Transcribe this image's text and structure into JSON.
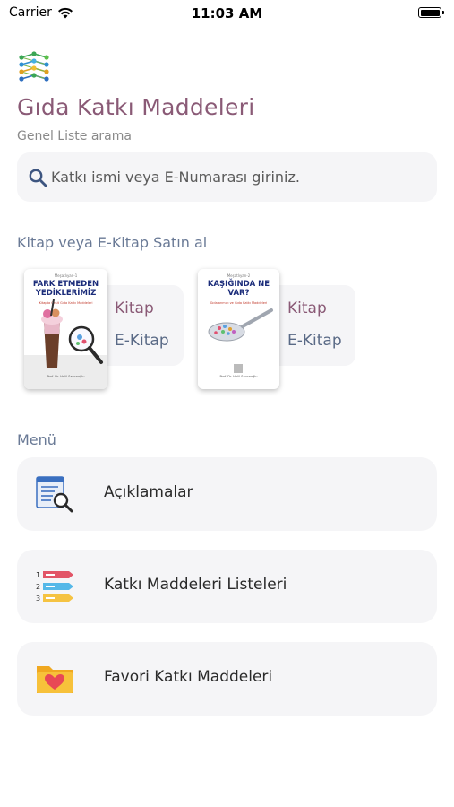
{
  "status_bar": {
    "carrier": "Carrier",
    "time": "11:03 AM"
  },
  "header": {
    "title": "Gıda Katkı Maddeleri",
    "subtitle": "Genel Liste arama"
  },
  "search": {
    "placeholder": "Katkı ismi veya E-Numarası giriniz."
  },
  "books_section": {
    "label": "Kitap veya E-Kitap Satın al",
    "books": [
      {
        "cover_series": "Meşatlıyan-1",
        "cover_title": "FARK ETMEDEN YEDİKLERİMİZ",
        "cover_subtitle": "Kitapta Çeşit Gıda Katkı Maddeleri",
        "cover_author": "Prof. Dr. Halil Sarıcaoğlu",
        "book_label": "Kitap",
        "ebook_label": "E-Kitap"
      },
      {
        "cover_series": "Meşatlıyan-2",
        "cover_title": "KAŞIĞINDA NE VAR?",
        "cover_subtitle": "Gıdalarımızı ve Gıda Katkı Maddeleri",
        "cover_author": "Prof. Dr. Halil Sarıcaoğlu",
        "book_label": "Kitap",
        "ebook_label": "E-Kitap"
      }
    ]
  },
  "menu": {
    "label": "Menü",
    "items": [
      {
        "label": "Açıklamalar",
        "icon": "document-search-icon"
      },
      {
        "label": "Katkı Maddeleri Listeleri",
        "icon": "numbered-list-icon"
      },
      {
        "label": "Favori Katkı Maddeleri",
        "icon": "favorite-folder-icon"
      }
    ]
  },
  "colors": {
    "title": "#8a5a76",
    "section_label": "#6a7a96",
    "card_bg": "#f5f5f7"
  }
}
